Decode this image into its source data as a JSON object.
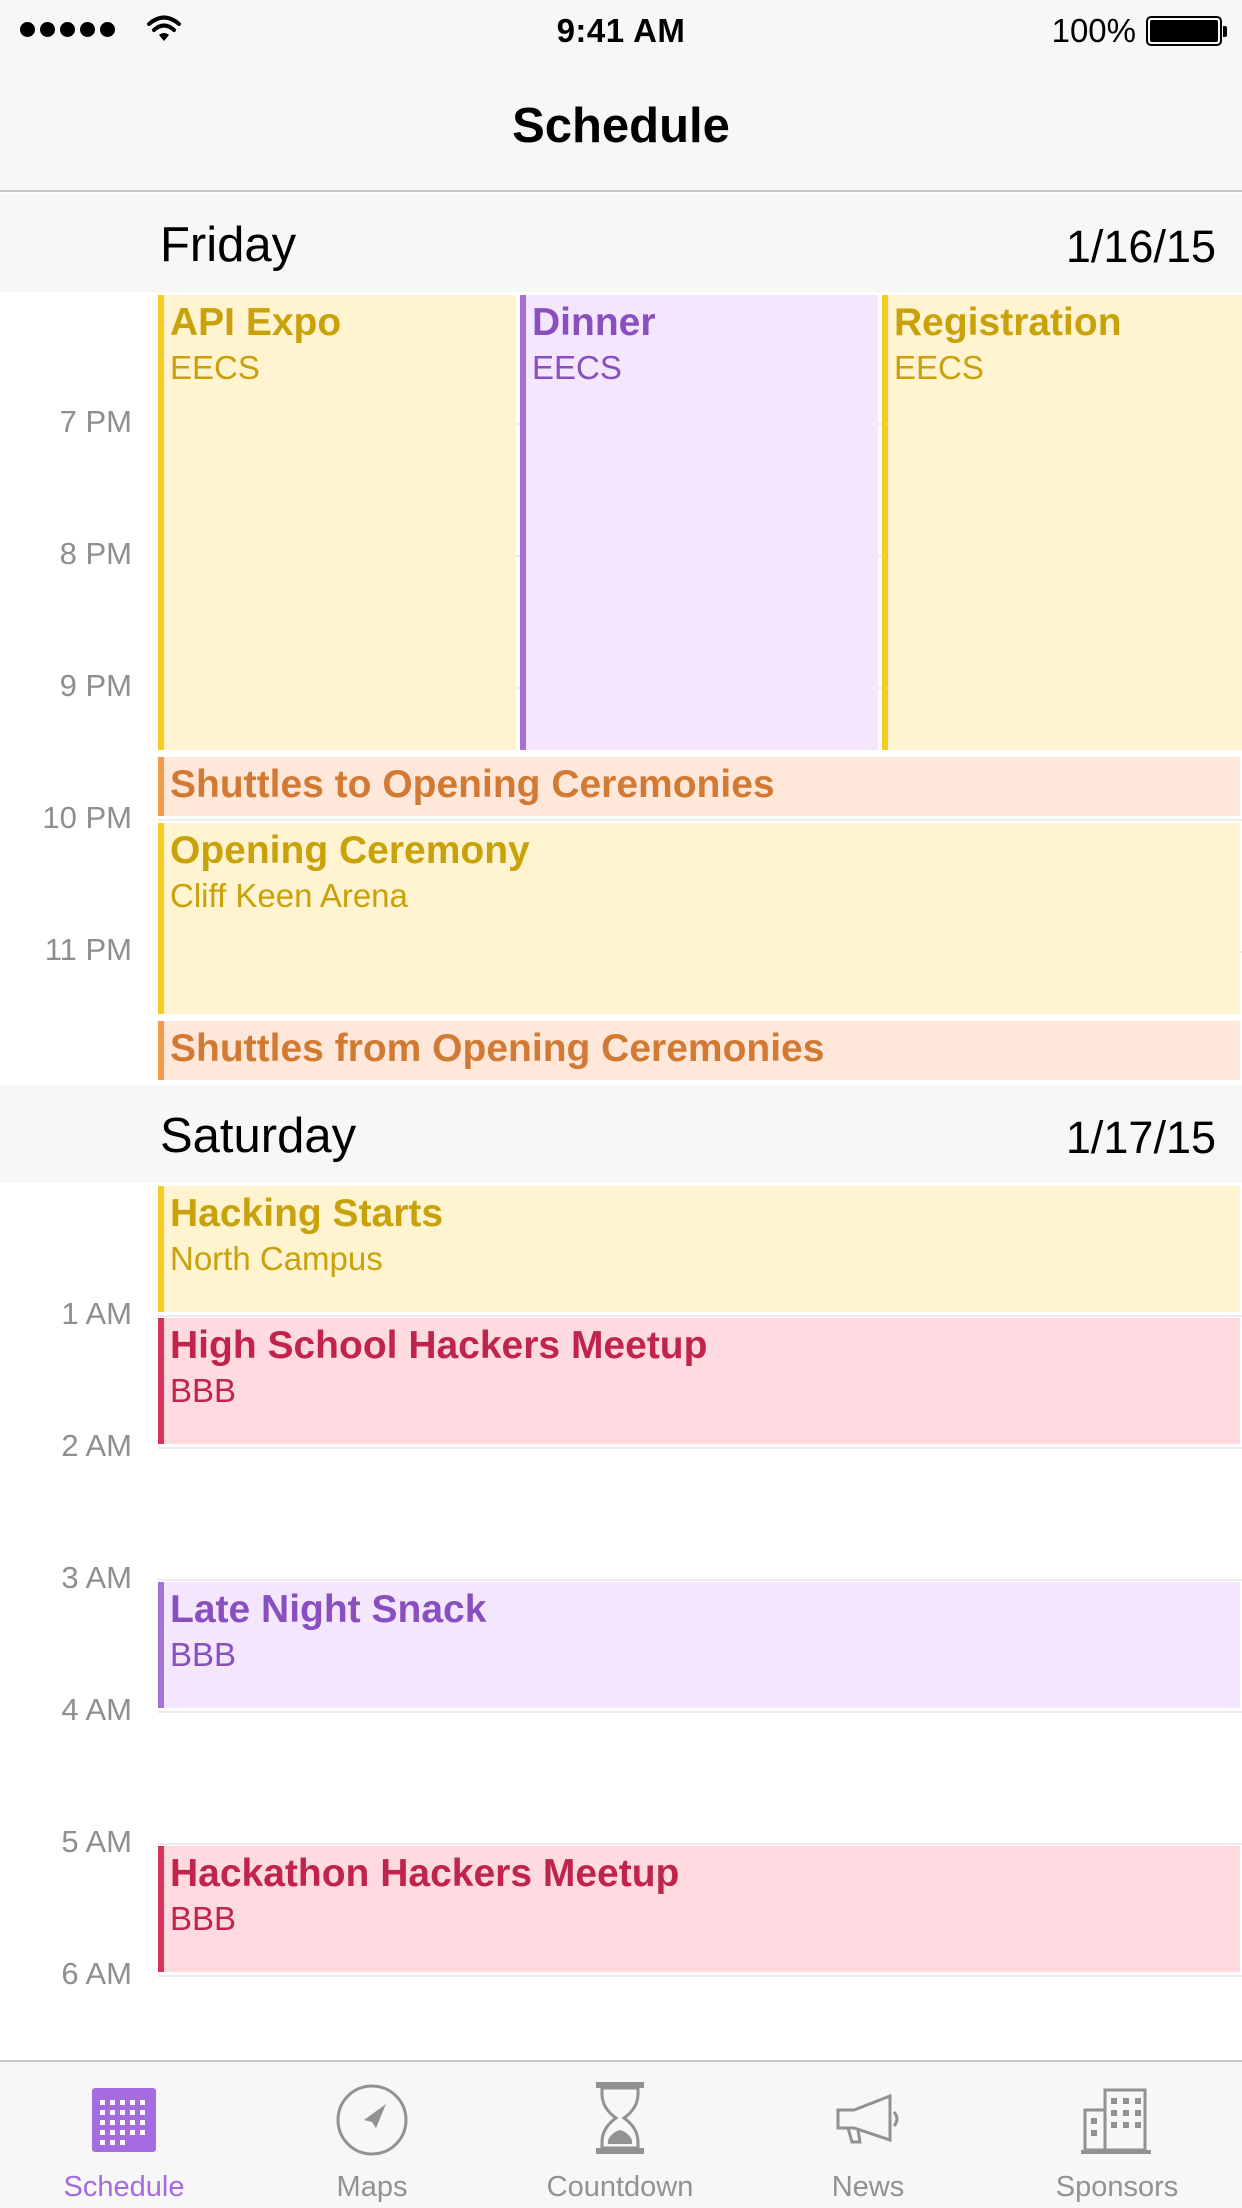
{
  "status_bar": {
    "time": "9:41 AM",
    "battery": "100%"
  },
  "nav": {
    "title": "Schedule"
  },
  "days": [
    {
      "name": "Friday",
      "date": "1/16/15"
    },
    {
      "name": "Saturday",
      "date": "1/17/15"
    }
  ],
  "hours": {
    "friday": [
      "7 PM",
      "8 PM",
      "9 PM",
      "10 PM",
      "11 PM"
    ],
    "saturday": [
      "1 AM",
      "2 AM",
      "3 AM",
      "4 AM",
      "5 AM",
      "6 AM"
    ]
  },
  "events": [
    {
      "title": "API Expo",
      "location": "EECS",
      "category": "yellow"
    },
    {
      "title": "Dinner",
      "location": "EECS",
      "category": "purple"
    },
    {
      "title": "Registration",
      "location": "EECS",
      "category": "yellow"
    },
    {
      "title": "Shuttles to Opening Ceremonies",
      "location": "",
      "category": "orange"
    },
    {
      "title": "Opening Ceremony",
      "location": "Cliff Keen Arena",
      "category": "yellow"
    },
    {
      "title": "Shuttles from Opening Ceremonies",
      "location": "",
      "category": "orange"
    },
    {
      "title": "Hacking Starts",
      "location": "North Campus",
      "category": "yellow"
    },
    {
      "title": "High School Hackers Meetup",
      "location": "BBB",
      "category": "red"
    },
    {
      "title": "Late Night Snack",
      "location": "BBB",
      "category": "purple"
    },
    {
      "title": "Hackathon Hackers Meetup",
      "location": "BBB",
      "category": "red"
    }
  ],
  "colors": {
    "yellow": {
      "bg": "#fff4cf",
      "bar": "#f5cd20",
      "text": "#c9a10b"
    },
    "purple": {
      "bg": "#f3e6fd",
      "bar": "#a471d9",
      "text": "#8a4fbf"
    },
    "orange": {
      "bg": "#ffe8d9",
      "bar": "#f39a4c",
      "text": "#d27a33"
    },
    "red": {
      "bg": "#ffdbe1",
      "bar": "#d8335a",
      "text": "#c0244a"
    },
    "accent": "#a56be0"
  },
  "tabs": [
    {
      "label": "Schedule",
      "icon": "calendar-grid-icon",
      "active": true
    },
    {
      "label": "Maps",
      "icon": "compass-icon",
      "active": false
    },
    {
      "label": "Countdown",
      "icon": "hourglass-icon",
      "active": false
    },
    {
      "label": "News",
      "icon": "megaphone-icon",
      "active": false
    },
    {
      "label": "Sponsors",
      "icon": "building-icon",
      "active": false
    }
  ]
}
